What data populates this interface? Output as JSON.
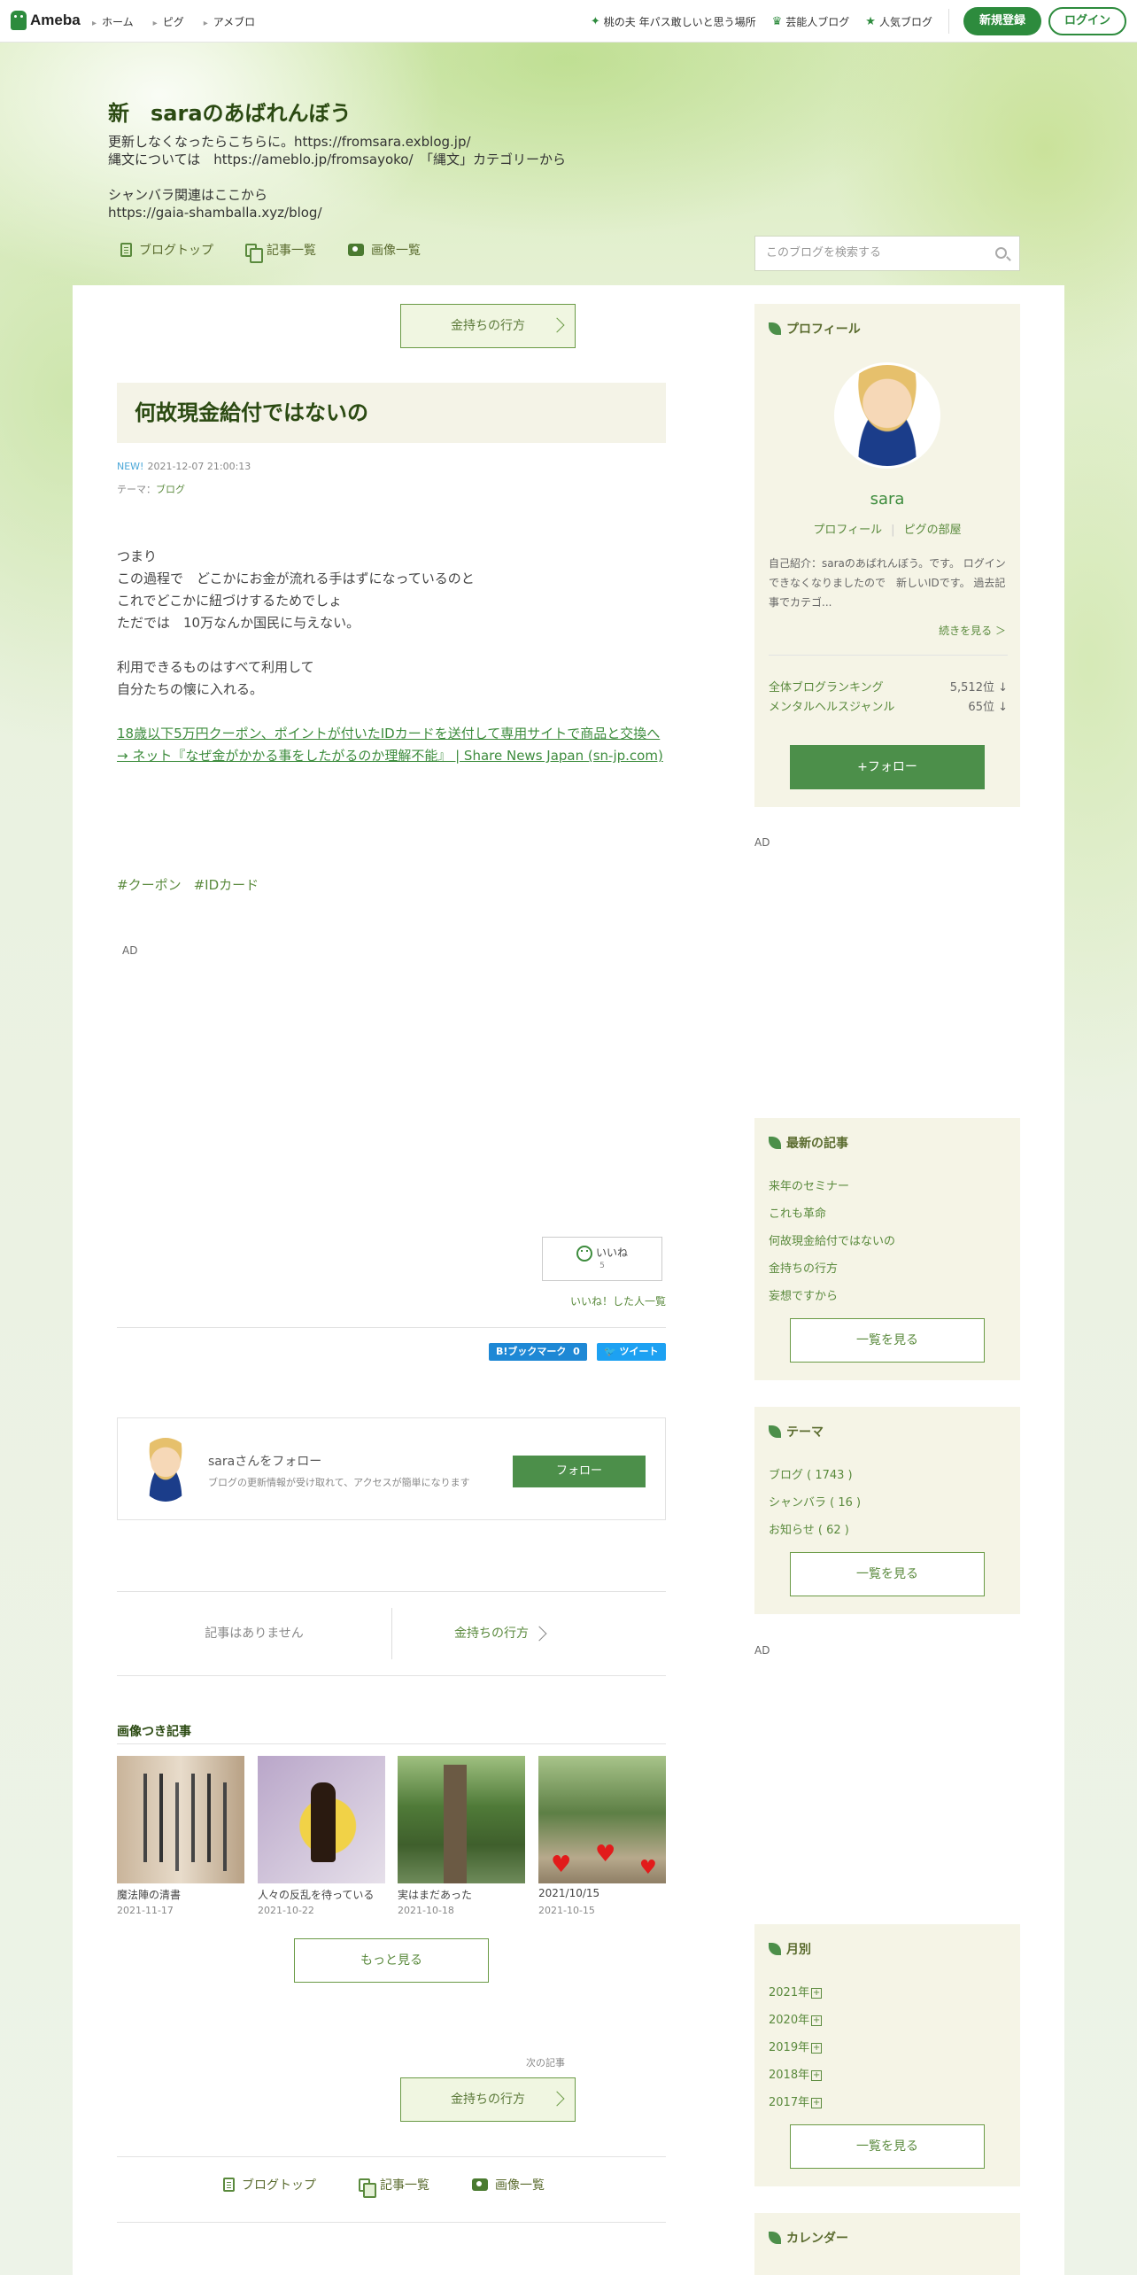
{
  "topbar": {
    "logo": "Ameba",
    "nav": [
      "ホーム",
      "ピグ",
      "アメブロ"
    ],
    "right_links": [
      {
        "label": "桃の夫 年パス敢しいと思う場所",
        "icon": "sparkle-icon"
      },
      {
        "label": "芸能人ブログ",
        "icon": "crown-icon"
      },
      {
        "label": "人気ブログ",
        "icon": "star-icon"
      }
    ],
    "register": "新規登録",
    "login": "ログイン"
  },
  "blog": {
    "title": "新　saraのあばれんぼう",
    "description": "更新しなくなったらこちらに。https://fromsara.exblog.jp/\n縄文については　https://ameblo.jp/fromsayoko/　「縄文」カテゴリーから\n\nシャンバラ関連はここから\nhttps://gaia-shamballa.xyz/blog/",
    "nav": [
      "ブログトップ",
      "記事一覧",
      "画像一覧"
    ],
    "search_placeholder": "このブログを検索する"
  },
  "article": {
    "prev_next_top": "金持ちの行方",
    "title": "何故現金給付ではないの",
    "new_badge": "NEW!",
    "datetime": "2021-12-07 21:00:13",
    "theme_label": "テーマ：",
    "theme": "ブログ",
    "body": "つまり\nこの過程で　どこかにお金が流れる手はずになっているのと\nこれでどこかに紐づけするためでしょ\nただでは　10万なんか国民に与えない。\n\n利用できるものはすべて利用して\n自分たちの懐に入れる。",
    "link": "18歳以下5万円クーポン、ポイントが付いたIDカードを送付して専用サイトで商品と交換へ → ネット『なぜ金がかかる事をしたがるのか理解不能』 | Share News Japan (sn-jp.com)",
    "tags": [
      "#クーポン",
      "#IDカード"
    ],
    "ad_label": "AD",
    "iine": "いいね",
    "iine_count": "5",
    "iine_list": "いいね！した人一覧",
    "hatena": "B!ブックマーク",
    "hatena_count": "0",
    "tweet": "ツイート",
    "follow_name": "saraさんをフォロー",
    "follow_desc": "ブログの更新情報が受け取れて、アクセスが簡単になります",
    "follow_btn": "フォロー",
    "prev_none": "記事はありません",
    "next": "金持ちの行方",
    "image_section": "画像つき記事",
    "images": [
      {
        "caption": "魔法陣の清書",
        "date": "2021-11-17"
      },
      {
        "caption": "人々の反乱を待っている",
        "date": "2021-10-22"
      },
      {
        "caption": "実はまだあった",
        "date": "2021-10-18"
      },
      {
        "caption": "2021/10/15",
        "date": "2021-10-15"
      }
    ],
    "more": "もっと見る",
    "next_label": "次の記事",
    "next_bottom": "金持ちの行方",
    "bottom_nav": [
      "ブログトップ",
      "記事一覧",
      "画像一覧"
    ]
  },
  "sidebar": {
    "profile_title": "プロフィール",
    "name": "sara",
    "profile_link": "プロフィール",
    "pig_link": "ピグの部屋",
    "self_intro": "自己紹介：saraのあばれんぼう。です。 ログインできなくなりましたので　新しいIDです。 過去記事でカテゴ...",
    "read_more": "続きを見る ＞",
    "rankings": [
      {
        "label": "全体ブログランキング",
        "value": "5,512位 ↓"
      },
      {
        "label": "メンタルヘルスジャンル",
        "value": "65位 ↓"
      }
    ],
    "follow": "+フォロー",
    "ad_label": "AD",
    "latest_title": "最新の記事",
    "latest": [
      "来年のセミナー",
      "これも革命",
      "何故現金給付ではないの",
      "金持ちの行方",
      "妄想ですから"
    ],
    "list_btn": "一覧を見る",
    "theme_title": "テーマ",
    "themes": [
      "ブログ ( 1743 )",
      "シャンバラ ( 16 )",
      "お知らせ ( 62 )"
    ],
    "month_title": "月別",
    "months": [
      "2021年",
      "2020年",
      "2019年",
      "2018年",
      "2017年"
    ],
    "calendar_title": "カレンダー"
  }
}
